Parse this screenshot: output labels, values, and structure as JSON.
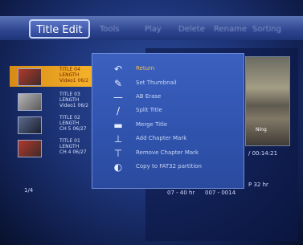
{
  "header": {
    "blurred_title": "",
    "tabs": [
      "Tools",
      "Play",
      "Delete",
      "Rename",
      "Sorting"
    ],
    "active_tab": "Title Edit"
  },
  "titles": [
    {
      "line1": "TITLE 04",
      "line2": "LENGTH",
      "line3": "Video1 06/2",
      "selected": true,
      "thumb": "red"
    },
    {
      "line1": "TITLE 03",
      "line2": "LENGTH",
      "line3": "Video1 06/2",
      "selected": false,
      "thumb": "gray"
    },
    {
      "line1": "TITLE 02",
      "line2": "LENGTH",
      "line3": "CH 5 06/27",
      "selected": false,
      "thumb": "dark"
    },
    {
      "line1": "TITLE 01",
      "line2": "LENGTH",
      "line3": "CH 4 06/27",
      "selected": false,
      "thumb": "red"
    }
  ],
  "page_indicator": "1/4",
  "right_info": {
    "time": "/ 00:14:21",
    "quality": "P 32 hr",
    "date": "07 - 40 hr",
    "extra": "007 - 0014"
  },
  "menu": {
    "items": [
      {
        "label": "Return",
        "icon": "return-icon",
        "active": true
      },
      {
        "label": "Set Thumbnail",
        "icon": "set-thumbnail-icon",
        "active": false
      },
      {
        "label": "AB Erase",
        "icon": "ab-erase-icon",
        "active": false
      },
      {
        "label": "Split Title",
        "icon": "split-title-icon",
        "active": false
      },
      {
        "label": "Merge Title",
        "icon": "merge-title-icon",
        "active": false
      },
      {
        "label": "Add Chapter Mark",
        "icon": "add-chapter-mark-icon",
        "active": false
      },
      {
        "label": "Remove Chapter Mark",
        "icon": "remove-chapter-mark-icon",
        "active": false
      },
      {
        "label": "Copy to FAT32 partition",
        "icon": "copy-fat32-icon",
        "active": false
      }
    ]
  },
  "preview_caption": "Ning"
}
